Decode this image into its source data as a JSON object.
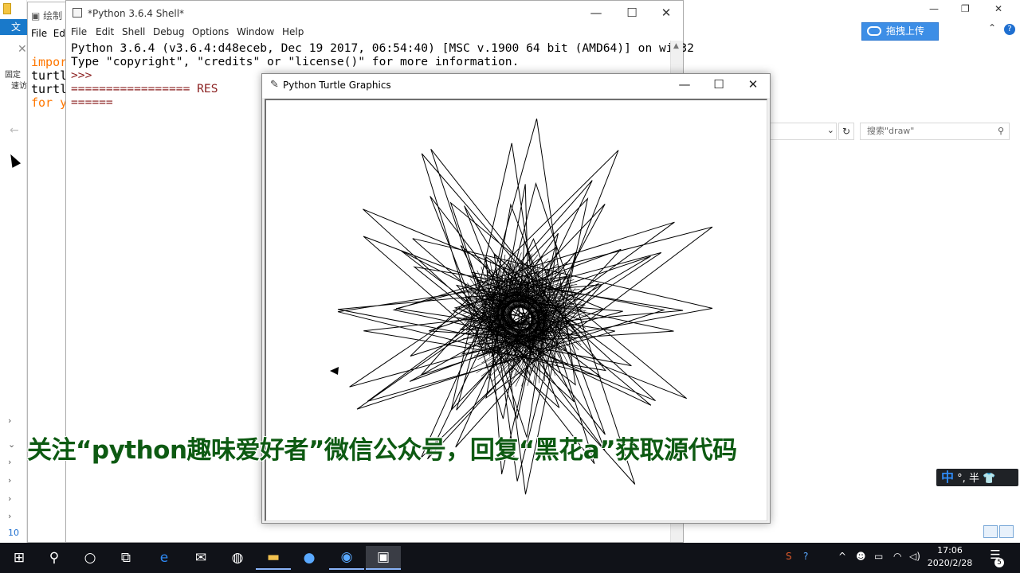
{
  "explorer": {
    "file_tab": "文件",
    "ribbon_fragment_1": "固定",
    "ribbon_fragment_2": "速访",
    "upload_label": "拖拽上传",
    "search_placeholder": "搜索\"draw\"",
    "tree_number": "10"
  },
  "editor_window": {
    "title": "绘制",
    "menu_file": "File",
    "menu_edit_fragment": "Ed",
    "code_lines": [
      "impor",
      "turtle",
      "turtle",
      "for y"
    ]
  },
  "shell_window": {
    "title": "*Python 3.6.4 Shell*",
    "menu": [
      "File",
      "Edit",
      "Shell",
      "Debug",
      "Options",
      "Window",
      "Help"
    ],
    "line1": "Python 3.6.4 (v3.6.4:d48eceb, Dec 19 2017, 06:54:40) [MSC v.1900 64 bit (AMD64)] on win32",
    "line2": "Type \"copyright\", \"credits\" or \"license()\" for more information.",
    "line3": ">>>",
    "line4": "================= RES",
    "line5": "======"
  },
  "turtle_window": {
    "title": "Python Turtle Graphics"
  },
  "caption": "关注“python趣味爱好者”微信公众号，回复“黑花a”获取源代码",
  "ime": {
    "mode": "中",
    "punct": "°,",
    "width": "半"
  },
  "taskbar": {
    "time": "17:06",
    "date": "2020/2/28",
    "notifications": "5"
  },
  "colors": {
    "caption": "#0d5a12",
    "keyword": "#ff7700",
    "upload_bg": "#3d8ee6",
    "taskbar_bg": "#101218"
  }
}
